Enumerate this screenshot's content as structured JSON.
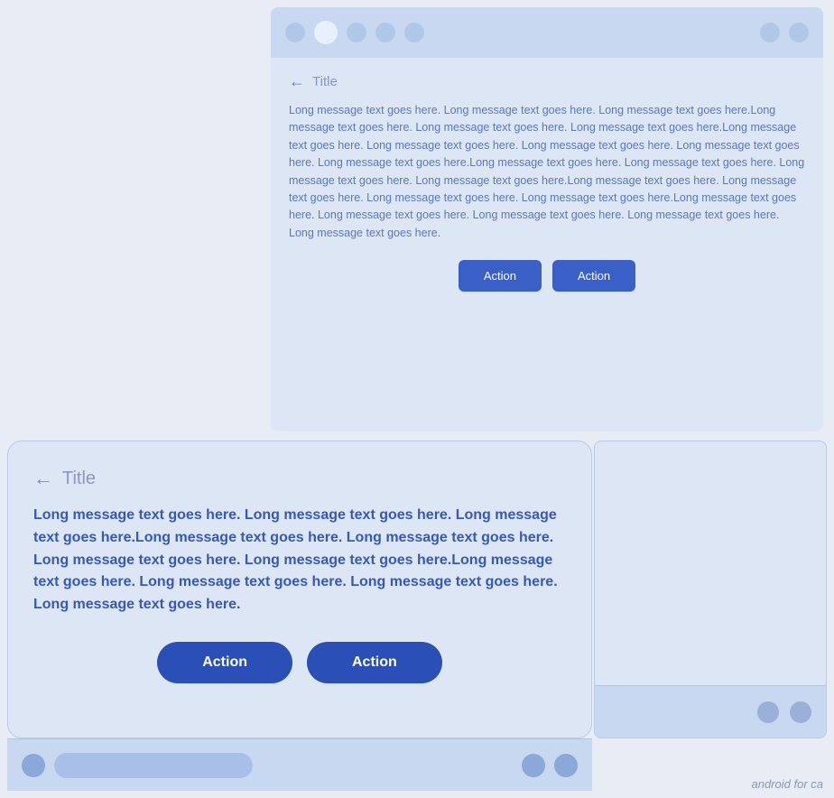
{
  "top_card": {
    "header": {
      "dots": [
        "dot-sm dot-light",
        "dot-md dot-white",
        "dot-sm dot-medium",
        "dot-sm dot-medium",
        "dot-sm dot-medium"
      ],
      "right_dots": [
        "dot-sm dot-medium",
        "dot-sm dot-medium"
      ]
    },
    "back_label": "←",
    "title": "Title",
    "message": "Long message text goes here. Long message text goes here. Long message text goes here.Long message text goes here. Long message text goes here. Long message text goes here.Long message text goes here. Long message text goes here. Long message text goes here. Long message text goes here. Long message text goes here.Long message text goes here. Long message text goes here. Long message text goes here. Long message text goes here.Long message text goes here. Long message text goes here. Long message text goes here. Long message text goes here.Long message text goes here. Long message text goes here. Long message text goes here. Long message text goes here. Long message text goes here.",
    "button1_label": "Action",
    "button2_label": "Action"
  },
  "bottom_card": {
    "back_label": "←",
    "title": "Title",
    "message": "Long message text goes here. Long message text goes here. Long message text goes here.Long message text goes here. Long message text goes here. Long message text goes here. Long message text goes here.Long message text goes here. Long message text goes here. Long message text goes here. Long message text goes here.",
    "button1_label": "Action",
    "button2_label": "Action"
  },
  "watermark": "android for ca"
}
